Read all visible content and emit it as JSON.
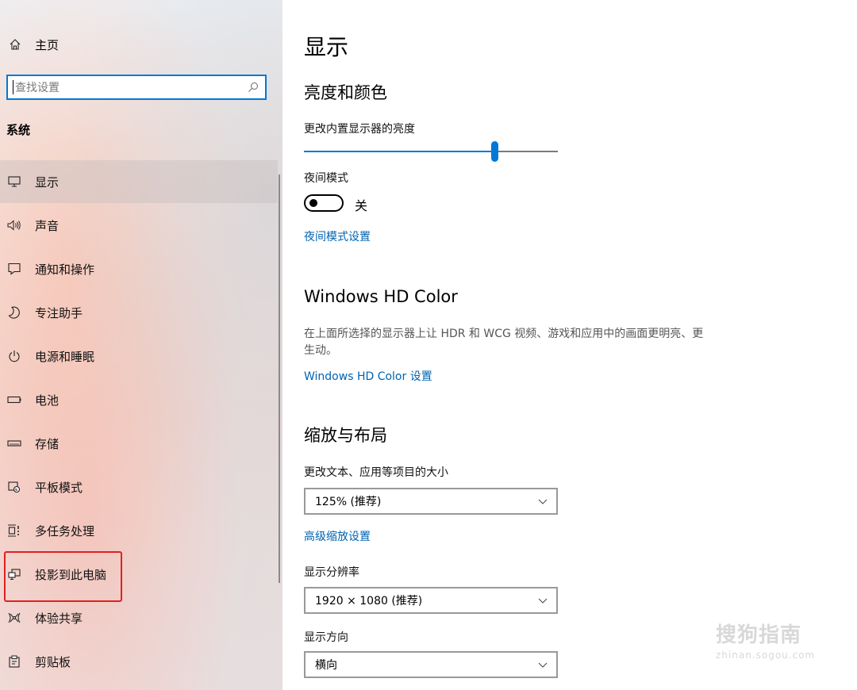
{
  "sidebar": {
    "home_label": "主页",
    "search_placeholder": "查找设置",
    "section_title": "系统",
    "items": [
      {
        "label": "显示",
        "icon": "monitor-icon",
        "active": true
      },
      {
        "label": "声音",
        "icon": "speaker-icon"
      },
      {
        "label": "通知和操作",
        "icon": "notification-icon"
      },
      {
        "label": "专注助手",
        "icon": "moon-icon"
      },
      {
        "label": "电源和睡眠",
        "icon": "power-icon"
      },
      {
        "label": "电池",
        "icon": "battery-icon"
      },
      {
        "label": "存储",
        "icon": "storage-icon"
      },
      {
        "label": "平板模式",
        "icon": "tablet-mode-icon"
      },
      {
        "label": "多任务处理",
        "icon": "multitasking-icon"
      },
      {
        "label": "投影到此电脑",
        "icon": "project-icon",
        "highlighted": true
      },
      {
        "label": "体验共享",
        "icon": "shared-experiences-icon"
      },
      {
        "label": "剪贴板",
        "icon": "clipboard-icon"
      }
    ]
  },
  "main": {
    "title": "显示",
    "brightness_section": {
      "title": "亮度和颜色",
      "brightness_label": "更改内置显示器的亮度",
      "brightness_value": 0.75,
      "night_mode_label": "夜间模式",
      "night_mode_state": "关",
      "night_mode_link": "夜间模式设置"
    },
    "hdr_section": {
      "title": "Windows HD Color",
      "description": "在上面所选择的显示器上让 HDR 和 WCG 视频、游戏和应用中的画面更明亮、更生动。",
      "link": "Windows HD Color 设置"
    },
    "scale_section": {
      "title": "缩放与布局",
      "scale_label": "更改文本、应用等项目的大小",
      "scale_value": "125% (推荐)",
      "advanced_link": "高级缩放设置",
      "resolution_label": "显示分辨率",
      "resolution_value": "1920 × 1080 (推荐)",
      "orientation_label": "显示方向",
      "orientation_value": "横向"
    }
  },
  "watermark": {
    "brand": "搜狗指南",
    "url": "zhinan.sogou.com"
  },
  "colors": {
    "accent": "#0078d7",
    "link": "#0063b1",
    "highlight_box": "#e02020"
  }
}
